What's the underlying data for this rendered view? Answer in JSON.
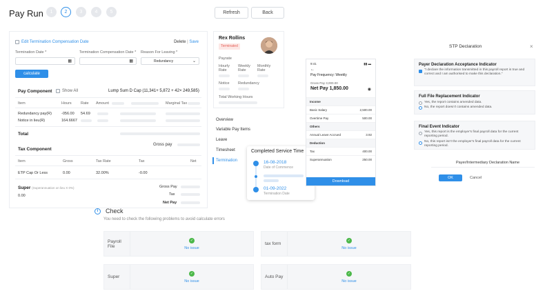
{
  "header": {
    "title": "Pay Run",
    "steps": [
      "1",
      "2",
      "3",
      "4",
      "5"
    ],
    "refresh": "Refresh",
    "back": "Back"
  },
  "termination": {
    "edit_label": "Edit Termination Compensation Date",
    "delete": "Delete",
    "sep": "|",
    "save": "Save",
    "termination_date_label": "Termination Date *",
    "compensation_date_label": "Termination Compensation Date *",
    "reason_label": "Reason For Leaving *",
    "reason_value": "Redundancy",
    "calculate": "calculate"
  },
  "pay_component": {
    "title": "Pay Component",
    "show_all": "Show All",
    "lump_sum": "Lump Sum D Cap (11,341+ 5,872 + 42× 249,585)",
    "columns": [
      "Item",
      "Hours",
      "Rate",
      "Amount",
      "Marginal Tax"
    ],
    "rows": [
      {
        "item": "Redundancy pay(R)",
        "hours": "-056.00",
        "rate": "54.69"
      },
      {
        "item": "Notice in lieu(R)",
        "hours": "164.6667",
        "rate": ""
      }
    ],
    "total": "Total",
    "gross_pay": "Gross pay"
  },
  "tax_component": {
    "title": "Tax Component",
    "columns": [
      "Item",
      "Gross",
      "Tax Rate",
      "Tax",
      "Net"
    ],
    "row": {
      "item": "ETP Cap Or Less",
      "gross": "0.00",
      "tax_rate": "32.00%",
      "tax": "-0.00"
    }
  },
  "super": {
    "title": "Super",
    "note": "(Superannuation on lieu X 0%)",
    "value": "0.00",
    "gross_pay": "Gross Pay",
    "tax": "Tax",
    "net_pay": "Net Pay"
  },
  "employee": {
    "name": "Rex Rollins",
    "status": "Terminated",
    "payrate": "Payrate",
    "hourly": "Hourly Rate",
    "weekly": "Weekly Rate",
    "monthly": "Monthly Rate",
    "notice": "Notice",
    "redundancy": "Redundancy",
    "total_hours": "Total Working Hours"
  },
  "nav": [
    "Overview",
    "Variable Pay Items",
    "Leave",
    "Timesheet",
    "Termination"
  ],
  "service": {
    "title": "Completed Service Time",
    "start_date": "16-08-2018",
    "start_label": "Date of Commence",
    "end_date": "01-09-2022",
    "end_label": "Termination Date"
  },
  "phone": {
    "time": "9:41",
    "frequency": "Pay Frequency: Weekly",
    "gross_label": "Gross Pay",
    "gross_value": "3,000.00",
    "net_label": "Net Pay",
    "net_value": "1,850.00",
    "income": "Income",
    "basic_salary": "Basic Salary",
    "basic_value": "2,500.00",
    "overtime": "Overtime Pay",
    "overtime_value": "500.00",
    "others": "Others",
    "annual_leave": "Annual Leave Accrued",
    "annual_value": "3.92",
    "deduction": "Deduction",
    "tax": "Tax",
    "tax_value": "400.00",
    "superannuation": "Superannuation",
    "super_value": "250.00",
    "download": "Download"
  },
  "stp": {
    "title": "STP Declaration",
    "close": "×",
    "payer_title": "Payer Declaration Acceptance Indicator",
    "payer_text": "\"I declare the information transmitted in this payroll report is true and correct and I am authorised to make this declaration.\"",
    "full_title": "Full File Replacement Indicator",
    "full_yes": "Yes, the report contains amended data.",
    "full_no": "No, the report doesn't contains amended data.",
    "final_title": "Final Event Indicator",
    "final_yes": "Yes, this report is the employer's final payroll data for the current reporting period.",
    "final_no": "No, this report isn't the employer's final payroll data for the current reporting period.",
    "name_label": "Payer/Intermediary Declaration Name",
    "ok": "OK",
    "cancel": "Cancel"
  },
  "check": {
    "title": "Check",
    "subtitle": "You need to check the following problems to avoid calculate errors",
    "items": [
      {
        "name": "Payroll File",
        "status": "No issue"
      },
      {
        "name": "tax form",
        "status": "No issue"
      },
      {
        "name": "Super",
        "status": "No issue"
      },
      {
        "name": "Auto Pay",
        "status": "No issue"
      }
    ]
  },
  "colors": {
    "accent": "#2f8fe8",
    "success": "#4cb84a",
    "danger": "#e4625a"
  }
}
